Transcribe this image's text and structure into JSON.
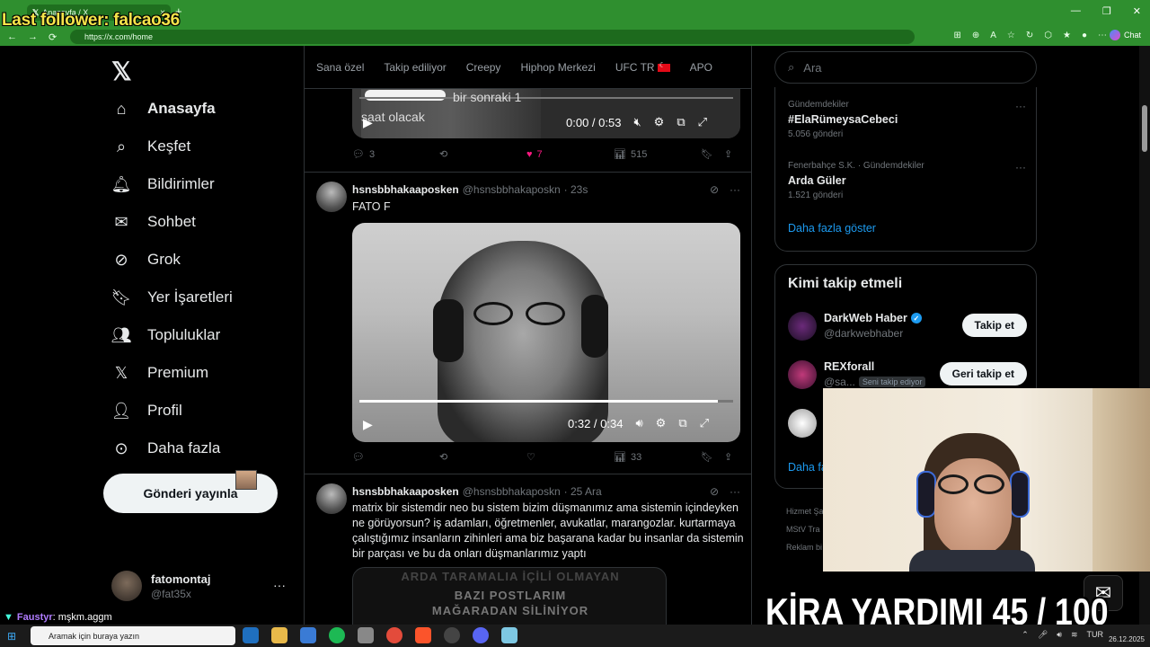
{
  "overlay": {
    "last_follower": "Last follower: falcao36",
    "goal": "KİRA YARDIMI  45 / 100",
    "chat_user": "Faustyr",
    "chat_message": ": mşkm.aggm"
  },
  "browser": {
    "tab_title": "Anasayfa / X",
    "url": "https://x.com/home",
    "chat_label": "Chat"
  },
  "sidebar": {
    "nav": [
      {
        "label": "Anasayfa",
        "icon": "home-icon"
      },
      {
        "label": "Keşfet",
        "icon": "search-icon"
      },
      {
        "label": "Bildirimler",
        "icon": "bell-icon"
      },
      {
        "label": "Sohbet",
        "icon": "mail-icon"
      },
      {
        "label": "Grok",
        "icon": "grok-icon"
      },
      {
        "label": "Yer İşaretleri",
        "icon": "bookmark-icon"
      },
      {
        "label": "Topluluklar",
        "icon": "people-icon"
      },
      {
        "label": "Premium",
        "icon": "x-icon"
      },
      {
        "label": "Profil",
        "icon": "person-icon"
      },
      {
        "label": "Daha fazla",
        "icon": "more-circle-icon"
      }
    ],
    "post_button": "Gönderi yayınla",
    "account_name": "fatomontaj",
    "account_handle": "@fat35x"
  },
  "tabs": [
    "Sana özel",
    "Takip ediliyor",
    "Creepy",
    "Hiphop Merkezi",
    "UFC TR",
    "APO"
  ],
  "post1": {
    "caption_line1": "bir sonraki 1",
    "caption_line2": "saat olacak",
    "time": "0:00 / 0:53",
    "replies": "3",
    "likes": "7",
    "views": "515"
  },
  "post2": {
    "name": "hsnsbbhakaaposken",
    "handle": "@hsnsbbhakaposkn",
    "time": "· 23s",
    "text": "FATO F",
    "video_time": "0:32 / 0:34",
    "video_progress": 0.96,
    "views": "33"
  },
  "post3": {
    "name": "hsnsbbhakaaposken",
    "handle": "@hsnsbbhakaposkn",
    "time": "· 25 Ara",
    "text": "matrix bir sistemdir neo bu sistem bizim düşmanımız ama sistemin içindeyken ne görüyorsun? iş adamları, öğretmenler, avukatlar, marangozlar. kurtarmaya çalıştığımız insanların zihinleri ama biz başarana kadar bu insanlar da sistemin bir parçası ve bu da onları düşmanlarımız yaptı",
    "thumb_line1": "ARDA TARAMALIA İÇİLİ OLMAYAN",
    "thumb_line2": "BAZI POSTLARIM",
    "thumb_line3": "MAĞARADAN SİLİNİYOR"
  },
  "right": {
    "search_placeholder": "Ara",
    "trends": [
      {
        "category": "Gündemdekiler",
        "title": "#ElaRümeysaCebeci",
        "count": "5.056 gönderi"
      },
      {
        "category": "Fenerbahçe S.K. · Gündemdekiler",
        "title": "Arda Güler",
        "count": "1.521 gönderi"
      }
    ],
    "show_more": "Daha fazla göster",
    "who_to_follow": "Kimi takip etmeli",
    "suggestions": [
      {
        "name": "DarkWeb Haber",
        "handle": "@darkwebhaber",
        "button": "Takip et",
        "verified": true
      },
      {
        "name": "REXforall",
        "handle": "@sa...",
        "button": "Geri takip et",
        "follows_you": "Seni takip ediyor"
      }
    ],
    "more_link": "Daha fa",
    "footer1": "Hizmet Şa",
    "footer2": "MStV Tra",
    "footer3": "Reklam bi"
  },
  "taskbar": {
    "search_text": "Aramak için buraya yazın",
    "lang": "TUR",
    "date": "26.12.2025"
  }
}
